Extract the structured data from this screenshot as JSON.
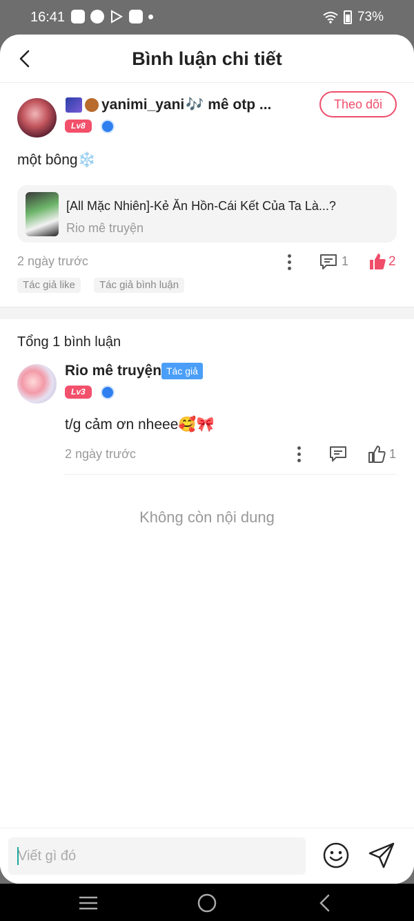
{
  "status_bar": {
    "time": "16:41",
    "battery": "73%",
    "icons": [
      "notification-icon",
      "cloud-icon",
      "play-store-icon",
      "app-icon",
      "wifi-icon",
      "battery-icon"
    ]
  },
  "header": {
    "title": "Bình luận chi tiết"
  },
  "post": {
    "username": "yanimi_yani",
    "username_suffix": "🎶 mê otp ...",
    "level": "Lv8",
    "follow_label": "Theo dõi",
    "text": "một bông",
    "text_emoji": "❄️",
    "story": {
      "title": "[All Mặc Nhiên]-Kẻ Ăn Hồn-Cái Kết Của Ta Là...?",
      "author": "Rio mê truyện"
    },
    "time": "2 ngày trước",
    "comment_count": "1",
    "like_count": "2",
    "tags": [
      "Tác giả like",
      "Tác giả bình luận"
    ]
  },
  "comments_section": {
    "total_label": "Tổng 1 bình luận",
    "replies": [
      {
        "name": "Rio mê truyện",
        "badge": "Tác giả",
        "level": "Lv3",
        "text": "t/g cảm ơn nheee",
        "emojis": "🥰🎀",
        "time": "2 ngày trước",
        "like_count": "1"
      }
    ],
    "end_label": "Không còn nội dung"
  },
  "input_bar": {
    "placeholder": "Viết gì đó"
  },
  "colors": {
    "accent": "#ef4d6a",
    "level_badge": "#f2506b",
    "author_badge": "#4a9ef7",
    "muted_text": "#999999"
  }
}
